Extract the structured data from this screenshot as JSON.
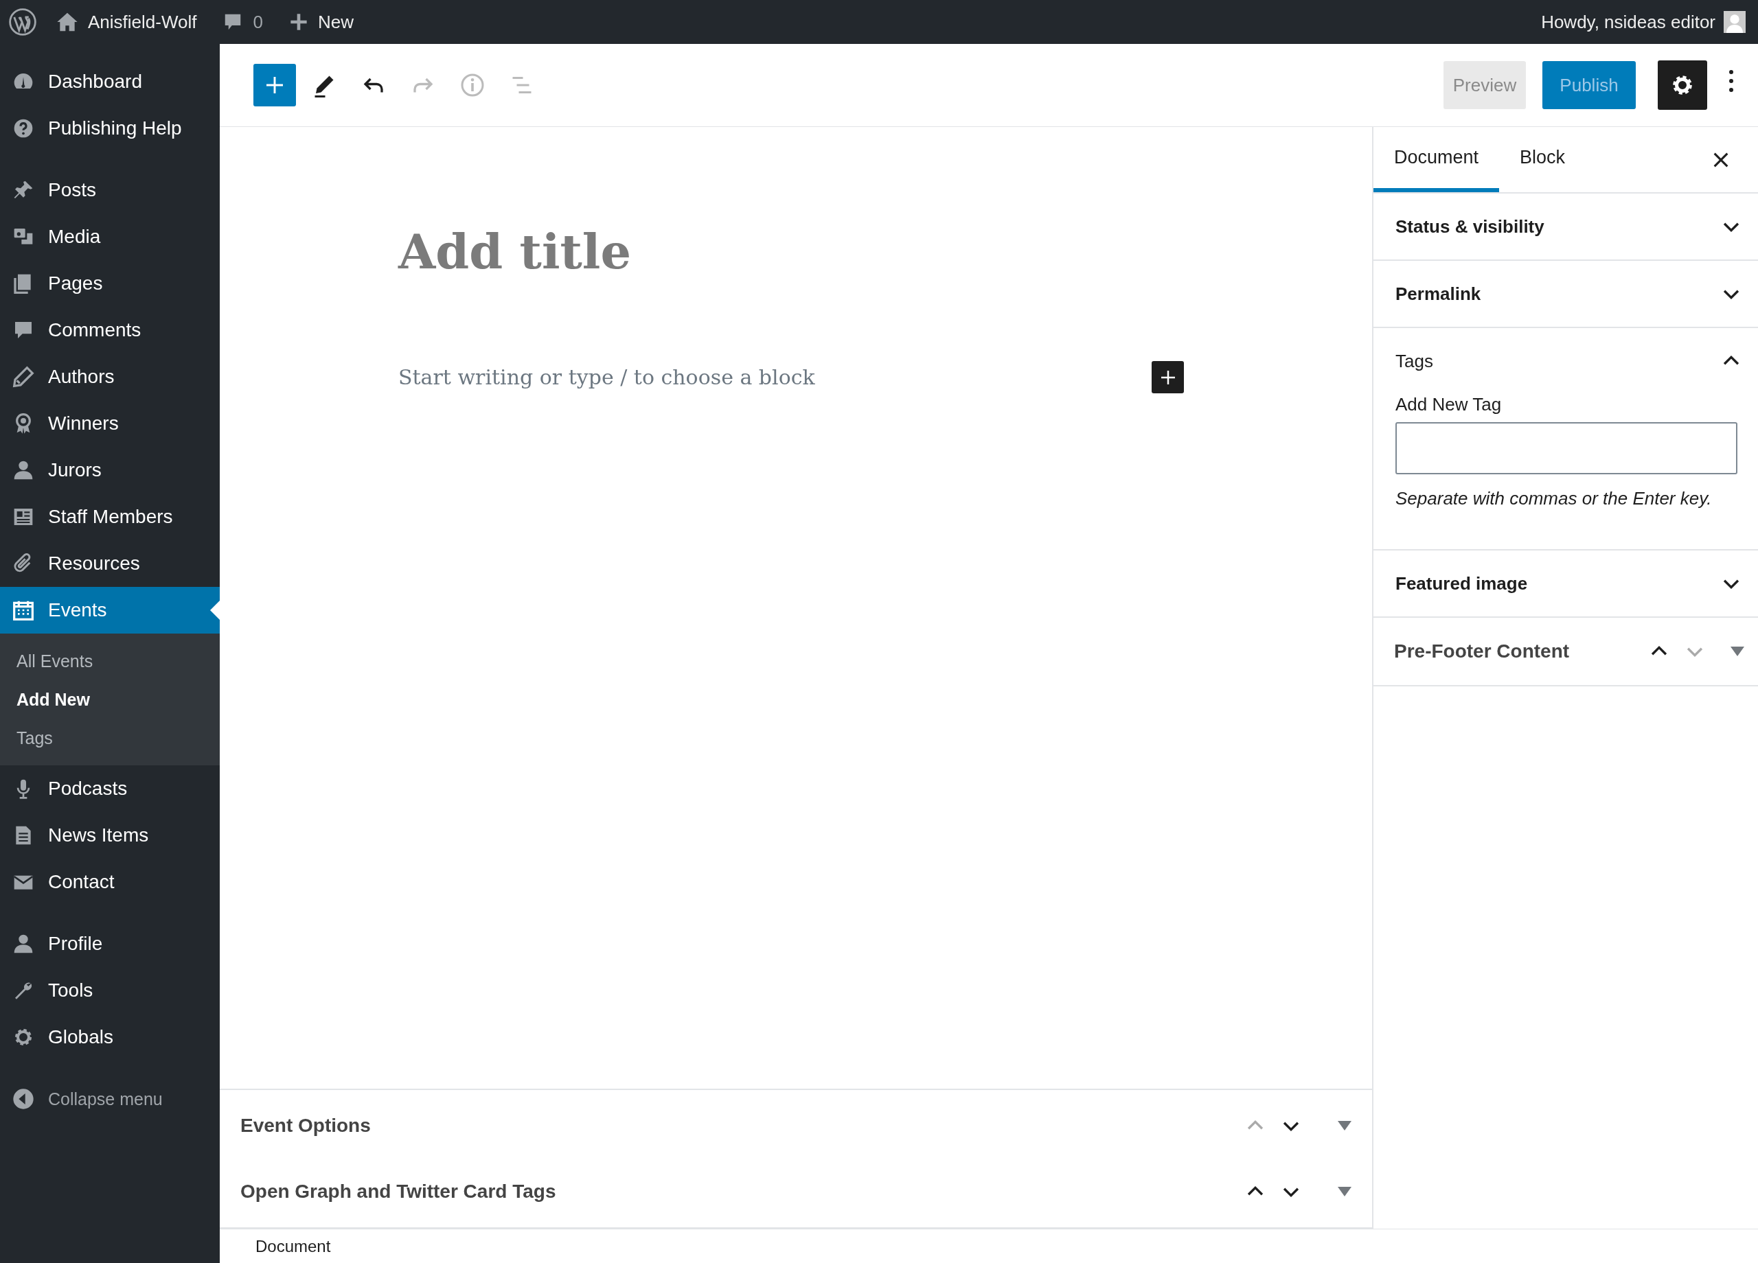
{
  "admin_bar": {
    "site_name": "Anisfield-Wolf",
    "comments_count": "0",
    "new_label": "New",
    "greeting": "Howdy, nsideas editor"
  },
  "sidebar": {
    "groups": [
      {
        "items": [
          {
            "label": "Dashboard",
            "selected": false
          },
          {
            "label": "Publishing Help",
            "selected": false
          }
        ]
      },
      {
        "items": [
          {
            "label": "Posts",
            "selected": false
          },
          {
            "label": "Media",
            "selected": false
          },
          {
            "label": "Pages",
            "selected": false
          },
          {
            "label": "Comments",
            "selected": false
          },
          {
            "label": "Authors",
            "selected": false
          },
          {
            "label": "Winners",
            "selected": false
          },
          {
            "label": "Jurors",
            "selected": false
          },
          {
            "label": "Staff Members",
            "selected": false
          },
          {
            "label": "Resources",
            "selected": false
          },
          {
            "label": "Events",
            "selected": true,
            "children": [
              {
                "label": "All Events",
                "selected": false
              },
              {
                "label": "Add New",
                "selected": true
              },
              {
                "label": "Tags",
                "selected": false
              }
            ]
          },
          {
            "label": "Podcasts",
            "selected": false
          },
          {
            "label": "News Items",
            "selected": false
          },
          {
            "label": "Contact",
            "selected": false
          }
        ]
      },
      {
        "items": [
          {
            "label": "Profile",
            "selected": false
          },
          {
            "label": "Tools",
            "selected": false
          },
          {
            "label": "Globals",
            "selected": false
          }
        ]
      }
    ],
    "collapse_label": "Collapse menu"
  },
  "toolbar": {
    "tools": [
      {
        "disabled": false
      },
      {
        "disabled": false
      },
      {
        "disabled": true
      },
      {
        "disabled": true
      },
      {
        "disabled": true
      }
    ]
  },
  "actions": {
    "preview": {
      "label": "Preview",
      "disabled": true
    },
    "publish": {
      "label": "Publish",
      "disabled": true
    },
    "settings_selected": true
  },
  "editor": {
    "title_placeholder": "Add title",
    "body_placeholder": "Start writing or type / to choose a block"
  },
  "settings_panel": {
    "tabs": [
      {
        "label": "Document",
        "selected": true
      },
      {
        "label": "Block",
        "selected": false
      }
    ],
    "panels": [
      {
        "kind": "panel",
        "title": "Status & visibility",
        "expanded": false
      },
      {
        "kind": "panel",
        "title": "Permalink",
        "expanded": false
      },
      {
        "kind": "panel",
        "title": "Tags",
        "expanded": true,
        "field_label": "Add New Tag",
        "help": "Separate with commas or the Enter key."
      },
      {
        "kind": "panel",
        "title": "Featured image",
        "expanded": false
      },
      {
        "kind": "metabox",
        "title": "Pre-Footer Content",
        "move_up_disabled": false,
        "move_down_disabled": true
      }
    ]
  },
  "meta_boxes": [
    {
      "title": "Event Options",
      "move_up_disabled": true,
      "move_down_disabled": false
    },
    {
      "title": "Open Graph and Twitter Card Tags",
      "move_up_disabled": false,
      "move_down_disabled": false
    }
  ],
  "footer": {
    "breadcrumb": "Document"
  }
}
